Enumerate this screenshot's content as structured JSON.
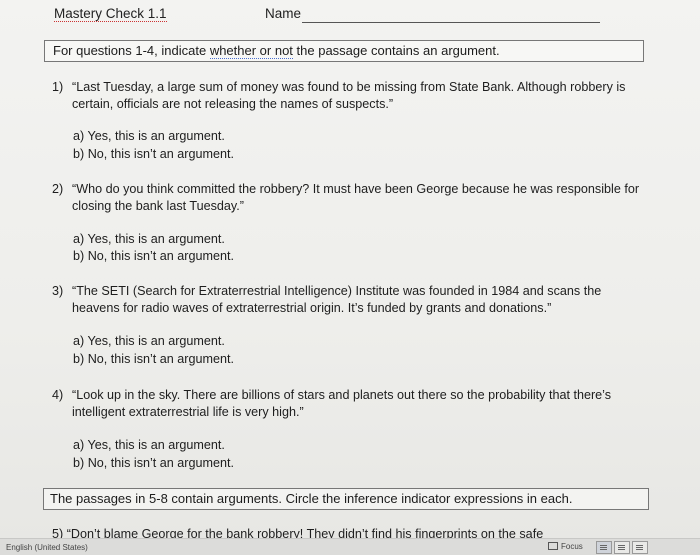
{
  "header": {
    "title": "Mastery Check 1.1",
    "name_label": "Name"
  },
  "instruction_1": {
    "prefix": "For questions 1-4, indicate ",
    "highlight": "whether or not",
    "suffix": " the passage contains an argument."
  },
  "questions": [
    {
      "number": "1)",
      "text": "“Last Tuesday, a large sum of money was found to be missing from State Bank. Although robbery is certain, officials are not releasing the names of suspects.”",
      "choice_a": "a) Yes, this is an argument.",
      "choice_b": "b) No, this isn’t an argument."
    },
    {
      "number": "2)",
      "text": "“Who do you think committed the robbery? It must have been George because he was responsible for closing the bank last Tuesday.”",
      "choice_a": "a) Yes, this is an argument.",
      "choice_b": "b) No, this isn’t an argument."
    },
    {
      "number": "3)",
      "text": "“The SETI (Search for Extraterrestrial Intelligence) Institute was founded in 1984 and scans the heavens for radio waves of extraterrestrial origin. It’s funded by grants and donations.”",
      "choice_a": "a) Yes, this is an argument.",
      "choice_b": "b) No, this isn’t an argument."
    },
    {
      "number": "4)",
      "text": "“Look up in the sky. There are billions of stars and planets out there so the probability that there’s intelligent extraterrestrial life is very high.”",
      "choice_a": "a) Yes, this is an argument.",
      "choice_b": "b) No, this isn’t an argument."
    }
  ],
  "instruction_2": "The passages in 5-8 contain arguments. Circle the inference indicator expressions in each.",
  "cutoff_text": "5)   “Don’t blame George for the bank robbery! They didn’t find his fingerprints on the safe",
  "statusbar": {
    "language": "English (United States)",
    "focus_label": "Focus"
  }
}
